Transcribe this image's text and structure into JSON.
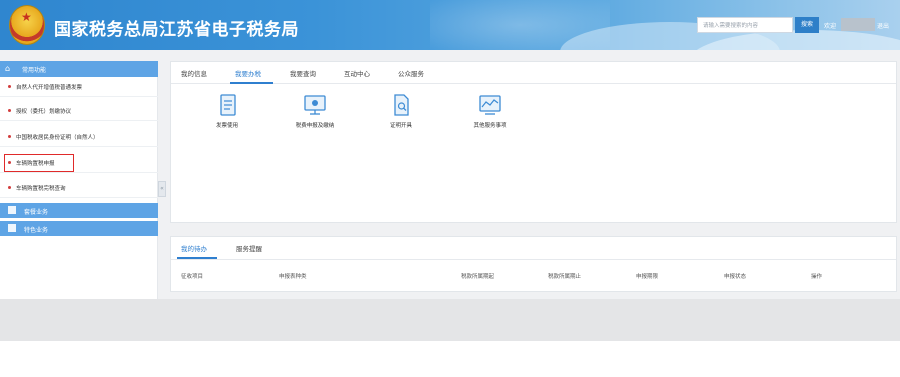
{
  "header": {
    "title": "国家税务总局江苏省电子税务局",
    "search_placeholder": "请输入需要搜索的内容",
    "search_button": "搜索",
    "welcome": "欢迎",
    "logout": "退出"
  },
  "sidebar": {
    "heading": "常用功能",
    "items": [
      {
        "label": "自然人代开增值税普通发票"
      },
      {
        "label": "授权（委托）划缴协议"
      },
      {
        "label": "中国税收居民身份证明（自然人）"
      },
      {
        "label": "车辆购置税申报"
      },
      {
        "label": "车辆购置税完税查询"
      }
    ],
    "categories": [
      {
        "label": "套餐业务"
      },
      {
        "label": "特色业务"
      }
    ],
    "collapse_glyph": "«"
  },
  "main": {
    "tabs": [
      {
        "label": "我的信息"
      },
      {
        "label": "我要办税"
      },
      {
        "label": "我要查询"
      },
      {
        "label": "互动中心"
      },
      {
        "label": "公众服务"
      }
    ],
    "active_tab": "我要办税",
    "functions": [
      {
        "label": "发票使用",
        "icon": "invoice-icon"
      },
      {
        "label": "税费申报及缴纳",
        "icon": "tax-declaration-icon"
      },
      {
        "label": "证明开具",
        "icon": "certificate-icon"
      },
      {
        "label": "其他服务事项",
        "icon": "other-services-icon"
      }
    ]
  },
  "todo": {
    "tabs": [
      {
        "label": "我的待办"
      },
      {
        "label": "服务提醒"
      }
    ],
    "columns": [
      {
        "label": "征收项目"
      },
      {
        "label": "申报表种类"
      },
      {
        "label": "税款所属期起"
      },
      {
        "label": "税款所属期止"
      },
      {
        "label": "申报期限"
      },
      {
        "label": "申报状态"
      },
      {
        "label": "操作"
      }
    ]
  },
  "colors": {
    "header_blue": "#2f86cf",
    "sidebar_blue": "#5ea4e5",
    "active_tab": "#2f7fcf",
    "highlight_frame": "#e02a2a"
  }
}
